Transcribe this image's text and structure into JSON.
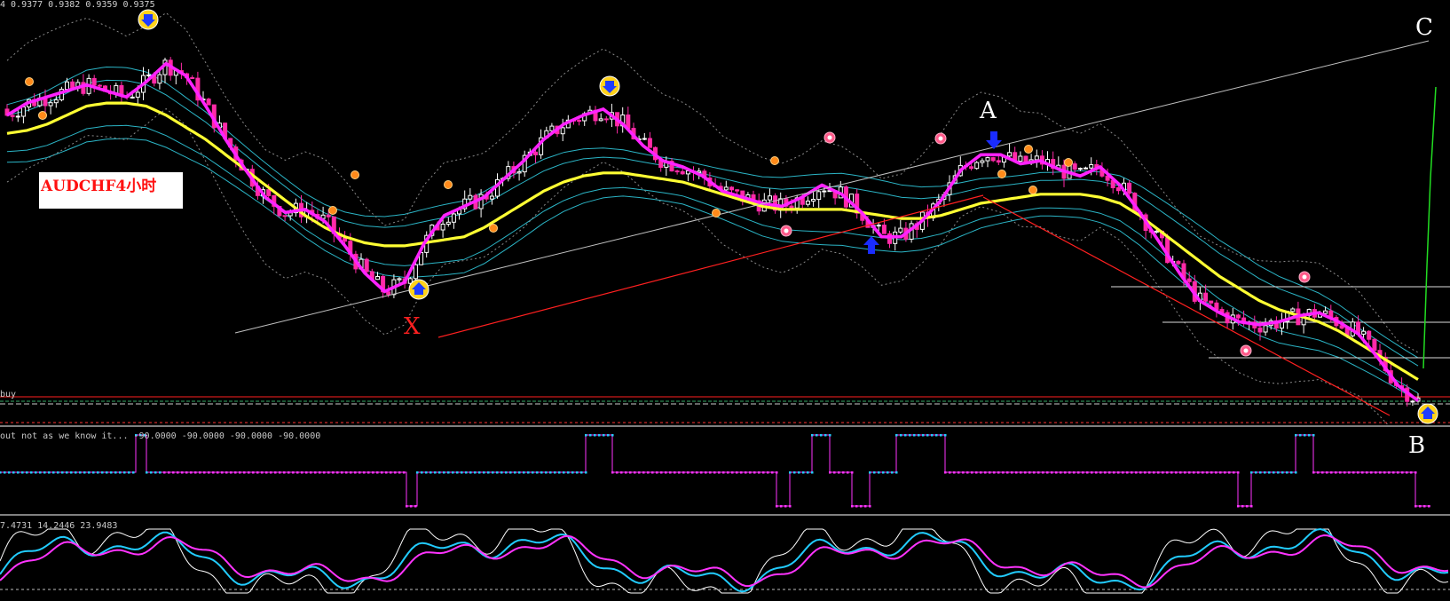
{
  "header": {
    "ohlc_readout": "4  0.9377 0.9382 0.9359 0.9375"
  },
  "symbol_box": {
    "label": "AUDCHF4小时"
  },
  "points": {
    "A": "A",
    "B": "B",
    "C": "C",
    "X": "X"
  },
  "main_panel": {
    "buy_label": "buy"
  },
  "indicator1": {
    "readout": "out not as we know it...  -90.0000 -90.0000 -90.0000 -90.0000"
  },
  "indicator2": {
    "readout": "7.4731 14.2446 23.9483"
  },
  "colors": {
    "background": "#000000",
    "bull_candle": "#ffffff",
    "bear_candle": "#ff2aa8",
    "ma_fast": "#ff22ff",
    "ma_slow": "#ffff33",
    "envelope": "#33d4e8",
    "trend_x_c": "#c0c0c0",
    "trend_x_a": "#ff2020",
    "trend_a_b": "#ff2020",
    "green_line": "#22dd22",
    "indicator_cyan": "#22ccff",
    "indicator_magenta": "#ff33ff",
    "osc_white": "#ffffff"
  },
  "chart_data": {
    "type": "line",
    "symbol": "AUDCHF",
    "series": [
      {
        "values": [
          0.935,
          0.9358,
          0.9362,
          0.9366,
          0.937,
          0.9366,
          0.9362,
          0.9372,
          0.9384,
          0.9376,
          0.9356,
          0.9334,
          0.9314,
          0.9296,
          0.9286,
          0.9288,
          0.928,
          0.9264,
          0.9246,
          0.9234,
          0.924,
          0.9266,
          0.9284,
          0.929,
          0.9296,
          0.9308,
          0.932,
          0.9334,
          0.9344,
          0.935,
          0.9354,
          0.9344,
          0.933,
          0.932,
          0.9316,
          0.931,
          0.93,
          0.9296,
          0.9292,
          0.929,
          0.9296,
          0.9304,
          0.9298,
          0.9286,
          0.927,
          0.927,
          0.928,
          0.9294,
          0.9314,
          0.9324,
          0.9324,
          0.9318,
          0.932,
          0.9314,
          0.931,
          0.9316,
          0.9304,
          0.9286,
          0.9266,
          0.9246,
          0.9228,
          0.922,
          0.9214,
          0.9212,
          0.9214,
          0.9218,
          0.922,
          0.9214,
          0.9206,
          0.919,
          0.9172,
          0.9162
        ]
      },
      {
        "values": [
          0.9338,
          0.934,
          0.9344,
          0.935,
          0.9356,
          0.9358,
          0.9358,
          0.9356,
          0.935,
          0.9342,
          0.9334,
          0.9324,
          0.9314,
          0.9304,
          0.9294,
          0.9284,
          0.9276,
          0.927,
          0.9266,
          0.9264,
          0.9264,
          0.9266,
          0.9268,
          0.927,
          0.9276,
          0.9284,
          0.9292,
          0.93,
          0.9306,
          0.931,
          0.9312,
          0.9312,
          0.931,
          0.9308,
          0.9306,
          0.9302,
          0.9298,
          0.9294,
          0.929,
          0.9288,
          0.9288,
          0.9288,
          0.9288,
          0.9286,
          0.9284,
          0.9282,
          0.9282,
          0.9284,
          0.9288,
          0.9292,
          0.9294,
          0.9296,
          0.9298,
          0.9298,
          0.9298,
          0.9296,
          0.9292,
          0.9284,
          0.9274,
          0.9264,
          0.9254,
          0.9244,
          0.9236,
          0.9228,
          0.9222,
          0.9218,
          0.9214,
          0.9208,
          0.92,
          0.9192,
          0.9184,
          0.9176
        ]
      }
    ],
    "annotations": [
      {
        "label": "X",
        "index": 27,
        "price": 0.9252
      },
      {
        "label": "A",
        "index": 40,
        "price": 0.9338
      },
      {
        "label": "B",
        "index": 71,
        "price": 0.9168
      },
      {
        "label": "C",
        "index": 71,
        "price": 0.9418
      }
    ]
  }
}
